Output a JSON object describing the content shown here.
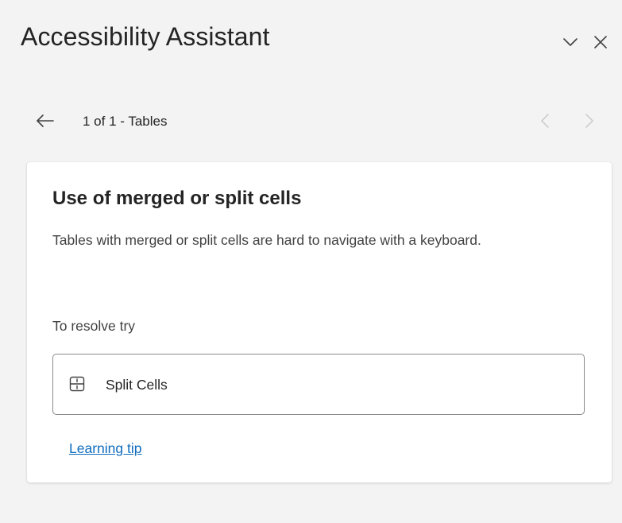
{
  "pane": {
    "title": "Accessibility Assistant",
    "collapse_icon": "chevron-down-icon",
    "close_icon": "close-icon"
  },
  "nav": {
    "back_icon": "arrow-left-icon",
    "position_label": "1 of 1 - Tables",
    "prev_icon": "chevron-left-icon",
    "next_icon": "chevron-right-icon",
    "prev_enabled": false,
    "next_enabled": false
  },
  "issue": {
    "title": "Use of merged or split cells",
    "description": "Tables with merged or split cells are hard to navigate with a keyboard.",
    "resolve_label": "To resolve try",
    "action": {
      "label": "Split Cells",
      "icon": "split-cells-icon"
    },
    "tip_link": "Learning tip"
  },
  "colors": {
    "pane_background": "#f3f3f3",
    "card_background": "#ffffff",
    "link": "#0f6cbd",
    "text": "#242424",
    "disabled_icon": "#c8c8c8"
  }
}
